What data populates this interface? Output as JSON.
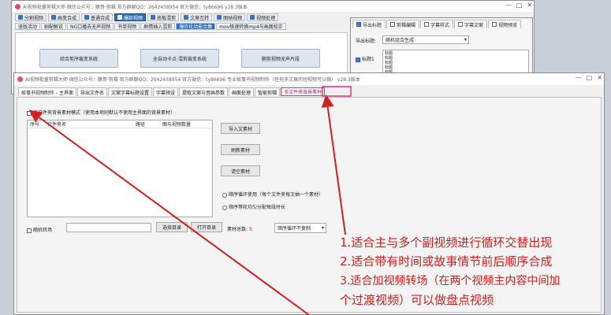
{
  "back_window": {
    "title": "AI视频批量剪辑大师  微信公众号：猿哥·剪辑  官方群聊QQ：2642458954  官方微信：ty86696  v28.3版本",
    "toolbar": [
      {
        "label": "分割视频",
        "icon": "split-icon",
        "active": false
      },
      {
        "label": "画变合成",
        "icon": "merge-icon",
        "active": false
      },
      {
        "label": "普通合成",
        "icon": "play-icon",
        "active": false
      },
      {
        "label": "爆款视频",
        "icon": "fire-icon",
        "active": true
      },
      {
        "label": "底板混剪",
        "icon": "mix-icon",
        "active": false
      },
      {
        "label": "文章互转",
        "icon": "text-icon",
        "active": false
      },
      {
        "label": "图帧视频",
        "icon": "image-icon",
        "active": false
      },
      {
        "label": "视频处理",
        "icon": "gear-icon",
        "active": false
      }
    ],
    "subtabs": [
      {
        "label": "竖版活动",
        "blue": false
      },
      {
        "label": "剧配解说",
        "blue": false
      },
      {
        "label": "NG口播去无声视频",
        "blue": false
      },
      {
        "label": "书单视频",
        "blue": false
      },
      {
        "label": "剧情插入混剪",
        "blue": false
      },
      {
        "label": "爆炸化功能合集",
        "blue": true
      },
      {
        "label": "mov极速转换mp4与画面校正",
        "blue": false
      }
    ],
    "tiles": [
      "综合剪序裁变系统",
      "全自动卡点·混剪裁变系统",
      "删剪视频无声片段"
    ]
  },
  "right_panel": {
    "tabs": [
      {
        "label": "导出标题",
        "active": true
      },
      {
        "label": "剪辑编辑",
        "active": false
      },
      {
        "label": "字幕样式",
        "active": false
      },
      {
        "label": "字幕文案",
        "active": false
      },
      {
        "label": "视频预览",
        "active": false
      }
    ],
    "export_label": "导出标题:",
    "export_select": "随机组合生成",
    "title_label": "标题1",
    "title_lines": [
      "标题",
      "标题",
      "标题",
      "标题",
      "标题",
      "标题"
    ]
  },
  "front_window": {
    "title": "AI视频批量剪辑大师  微信公众号：猿哥·剪辑  官方群聊QQ：2642458954  官方微信：ty86696  专业故事书视频制作（任何多文章的短视频可以做）  v28.3版本",
    "tabs": [
      {
        "label": "故事书视频制作 - 主界面",
        "state": "active"
      },
      {
        "label": "导出文件名",
        "state": ""
      },
      {
        "label": "文案字幕标题设置",
        "state": ""
      },
      {
        "label": "字幕预设",
        "state": ""
      },
      {
        "label": "提取文案与音画参数",
        "state": ""
      },
      {
        "label": "画面处理",
        "state": ""
      },
      {
        "label": "智能剪辑",
        "state": ""
      },
      {
        "label": "多文件夹背景素材",
        "state": "highlight"
      }
    ],
    "checkbox_label": "多文件夹背景素材模式（使用本项则默认不使用主界面的背景素材）",
    "table_headers": [
      "序号",
      "文件夹名",
      "路径",
      "图与视频数量"
    ],
    "buttons": {
      "import": "导入文素材",
      "refresh": "刷新素材",
      "clear": "请空素材"
    },
    "radio_options": [
      "顺序循环使用（每个文件夹每次抽一个素材）",
      "顺序等轮均匀分配每段时长"
    ],
    "bottom": {
      "transition_label": "随机转场",
      "path_value": "",
      "select_dir": "选择目录",
      "open_dir": "打开目录",
      "count_label": "素材总数:",
      "count_value": "5",
      "mode_select": "顺序循环不复制"
    }
  },
  "annotations": [
    "1.适合主与多个副视频进行循环交替出现",
    "2.适合带有时间或故事情节前后顺序合成",
    "3.适合加视频转场（在两个视频主内容中间加",
    "个过渡视频）可以做盘点视频"
  ],
  "colors": {
    "accent": "#2a6ebd",
    "annotation": "#d02020",
    "highlight": "#e0308a"
  }
}
